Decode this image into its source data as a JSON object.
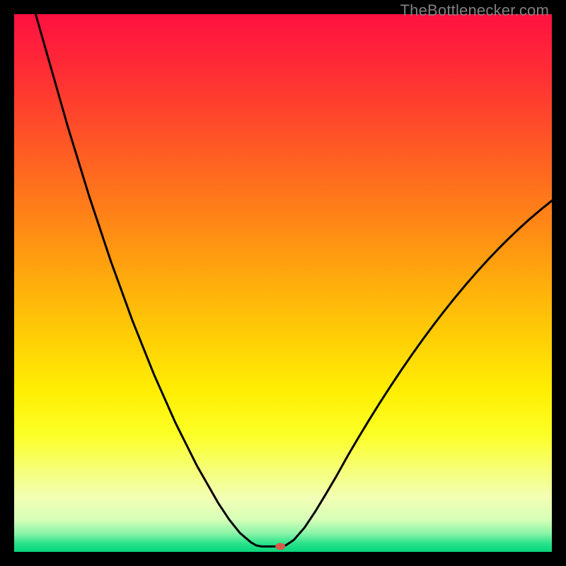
{
  "watermark": "TheBottlenecker.com",
  "chart_data": {
    "type": "line",
    "title": "",
    "xlabel": "",
    "ylabel": "",
    "xlim": [
      0,
      100
    ],
    "ylim": [
      0,
      100
    ],
    "background_gradient": {
      "stops": [
        {
          "offset": 0.0,
          "color": "#ff1140"
        },
        {
          "offset": 0.1,
          "color": "#ff2b36"
        },
        {
          "offset": 0.2,
          "color": "#ff4a2a"
        },
        {
          "offset": 0.3,
          "color": "#ff6a1f"
        },
        {
          "offset": 0.4,
          "color": "#ff8b15"
        },
        {
          "offset": 0.5,
          "color": "#ffad0c"
        },
        {
          "offset": 0.6,
          "color": "#ffce06"
        },
        {
          "offset": 0.7,
          "color": "#ffee03"
        },
        {
          "offset": 0.78,
          "color": "#fcff24"
        },
        {
          "offset": 0.85,
          "color": "#f6ff7a"
        },
        {
          "offset": 0.9,
          "color": "#f2ffb5"
        },
        {
          "offset": 0.94,
          "color": "#d7ffb8"
        },
        {
          "offset": 0.965,
          "color": "#8cf5a8"
        },
        {
          "offset": 0.985,
          "color": "#27e28a"
        },
        {
          "offset": 1.0,
          "color": "#07d77c"
        }
      ]
    },
    "curve_points": [
      {
        "x": 4.0,
        "y": 100.0
      },
      {
        "x": 6.0,
        "y": 93.0
      },
      {
        "x": 8.0,
        "y": 86.0
      },
      {
        "x": 10.0,
        "y": 79.0
      },
      {
        "x": 12.0,
        "y": 72.5
      },
      {
        "x": 14.0,
        "y": 66.0
      },
      {
        "x": 16.0,
        "y": 60.0
      },
      {
        "x": 18.0,
        "y": 54.0
      },
      {
        "x": 20.0,
        "y": 48.5
      },
      {
        "x": 22.0,
        "y": 43.0
      },
      {
        "x": 24.0,
        "y": 38.0
      },
      {
        "x": 26.0,
        "y": 33.0
      },
      {
        "x": 28.0,
        "y": 28.5
      },
      {
        "x": 30.0,
        "y": 24.0
      },
      {
        "x": 32.0,
        "y": 20.0
      },
      {
        "x": 34.0,
        "y": 16.0
      },
      {
        "x": 36.0,
        "y": 12.5
      },
      {
        "x": 38.0,
        "y": 9.0
      },
      {
        "x": 40.0,
        "y": 6.0
      },
      {
        "x": 42.0,
        "y": 3.5
      },
      {
        "x": 44.0,
        "y": 1.8
      },
      {
        "x": 45.0,
        "y": 1.2
      },
      {
        "x": 46.0,
        "y": 1.0
      },
      {
        "x": 48.0,
        "y": 1.0
      },
      {
        "x": 49.5,
        "y": 1.0
      },
      {
        "x": 50.5,
        "y": 1.2
      },
      {
        "x": 52.0,
        "y": 2.2
      },
      {
        "x": 54.0,
        "y": 4.5
      },
      {
        "x": 56.0,
        "y": 7.5
      },
      {
        "x": 58.0,
        "y": 10.8
      },
      {
        "x": 60.0,
        "y": 14.2
      },
      {
        "x": 62.0,
        "y": 17.8
      },
      {
        "x": 64.0,
        "y": 21.2
      },
      {
        "x": 66.0,
        "y": 24.5
      },
      {
        "x": 68.0,
        "y": 27.7
      },
      {
        "x": 70.0,
        "y": 30.8
      },
      {
        "x": 72.0,
        "y": 33.8
      },
      {
        "x": 74.0,
        "y": 36.7
      },
      {
        "x": 76.0,
        "y": 39.5
      },
      {
        "x": 78.0,
        "y": 42.2
      },
      {
        "x": 80.0,
        "y": 44.8
      },
      {
        "x": 82.0,
        "y": 47.3
      },
      {
        "x": 84.0,
        "y": 49.7
      },
      {
        "x": 86.0,
        "y": 52.0
      },
      {
        "x": 88.0,
        "y": 54.2
      },
      {
        "x": 90.0,
        "y": 56.3
      },
      {
        "x": 92.0,
        "y": 58.3
      },
      {
        "x": 94.0,
        "y": 60.2
      },
      {
        "x": 96.0,
        "y": 62.0
      },
      {
        "x": 98.0,
        "y": 63.7
      },
      {
        "x": 100.0,
        "y": 65.3
      }
    ],
    "marker": {
      "x": 49.5,
      "y": 1.0,
      "color": "#d85a4a",
      "rx": 7,
      "ry": 5
    }
  }
}
